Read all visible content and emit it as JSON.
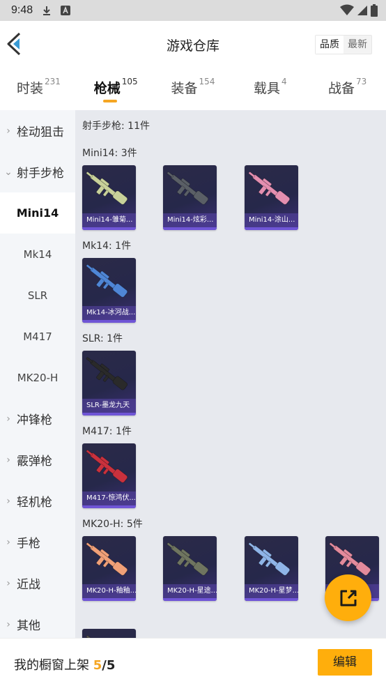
{
  "status_bar": {
    "time": "9:48",
    "icons": [
      "download-icon",
      "a-box-icon",
      "wifi-icon",
      "signal-icon",
      "battery-icon"
    ]
  },
  "header": {
    "title": "游戏仓库",
    "sort": {
      "quality": "品质",
      "newest": "最新",
      "active": "quality"
    }
  },
  "tabs": [
    {
      "label": "时装",
      "count": "231"
    },
    {
      "label": "枪械",
      "count": "105",
      "active": true
    },
    {
      "label": "装备",
      "count": "154"
    },
    {
      "label": "载具",
      "count": "4"
    },
    {
      "label": "战备",
      "count": "73"
    }
  ],
  "sidebar": {
    "items": [
      {
        "label": "栓动狙击",
        "chevron": "right"
      },
      {
        "label": "射手步枪",
        "chevron": "down"
      },
      {
        "label": "Mini14",
        "sub": true,
        "active": true
      },
      {
        "label": "Mk14",
        "sub": true
      },
      {
        "label": "SLR",
        "sub": true
      },
      {
        "label": "M417",
        "sub": true
      },
      {
        "label": "MK20-H",
        "sub": true
      },
      {
        "label": "冲锋枪",
        "chevron": "right"
      },
      {
        "label": "霰弹枪",
        "chevron": "right"
      },
      {
        "label": "轻机枪",
        "chevron": "right"
      },
      {
        "label": "手枪",
        "chevron": "right"
      },
      {
        "label": "近战",
        "chevron": "right"
      },
      {
        "label": "其他",
        "chevron": "right"
      }
    ]
  },
  "content": {
    "summary": "射手步枪: 11件",
    "groups": [
      {
        "title": "Mini14: 3件",
        "items": [
          {
            "name": "Mini14-雏菊...",
            "color": "#c8d19a"
          },
          {
            "name": "Mini14-炫彩...",
            "color": "#5a5f66"
          },
          {
            "name": "Mini14-涂山...",
            "color": "#e48fb0"
          }
        ]
      },
      {
        "title": "Mk14: 1件",
        "items": [
          {
            "name": "Mk14-冰河战...",
            "color": "#4f86d6"
          }
        ]
      },
      {
        "title": "SLR: 1件",
        "items": [
          {
            "name": "SLR-墨龙九天",
            "color": "#2a2a2a"
          }
        ]
      },
      {
        "title": "M417: 1件",
        "items": [
          {
            "name": "M417-惊鸿伏...",
            "color": "#c9313d"
          }
        ]
      },
      {
        "title": "MK20-H: 5件",
        "items": [
          {
            "name": "MK20-H-釉釉...",
            "color": "#f0a078"
          },
          {
            "name": "MK20-H-星途...",
            "color": "#6f7560"
          },
          {
            "name": "MK20-H-星梦...",
            "color": "#8fb5e8"
          },
          {
            "name": "",
            "color": "#e38a9c"
          },
          {
            "name": "",
            "color": "#55524a"
          }
        ]
      }
    ]
  },
  "fab": {
    "icon": "share-external-icon"
  },
  "bottom_bar": {
    "shelf_label": "我的橱窗上架",
    "shelf_count": "5",
    "shelf_sep": "/",
    "shelf_total": "5",
    "edit_label": "编辑"
  }
}
